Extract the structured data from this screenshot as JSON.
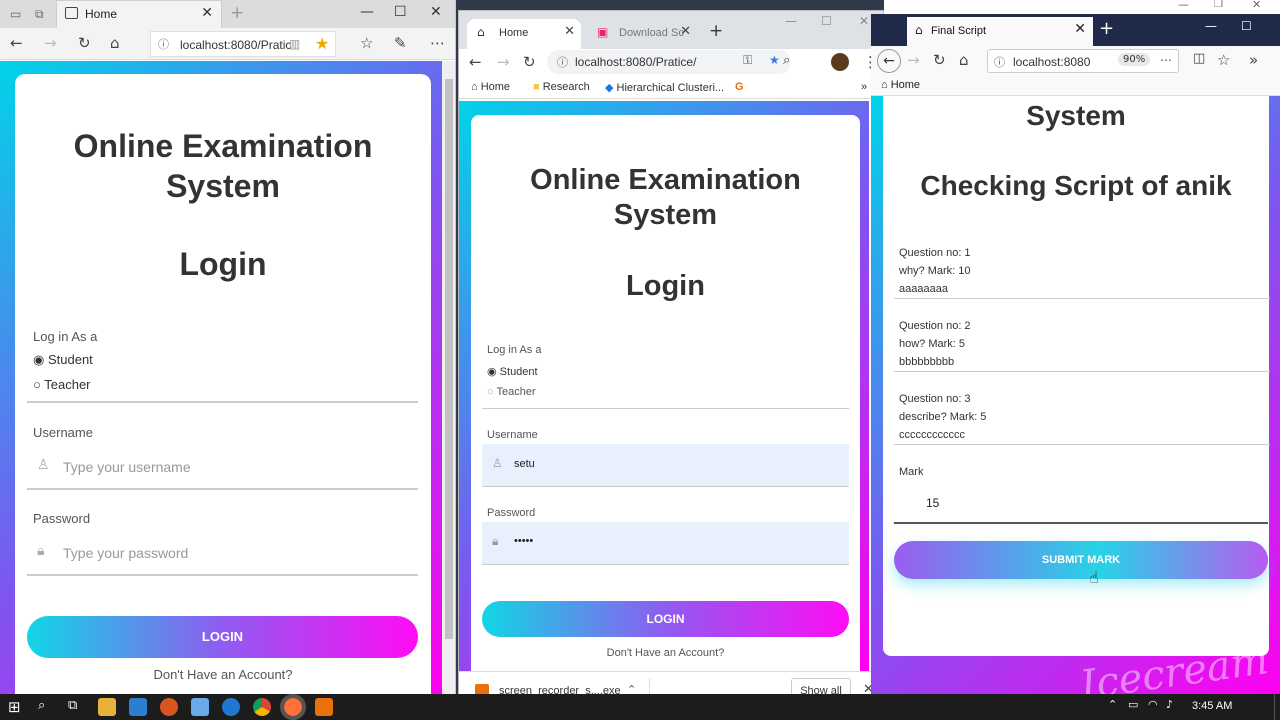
{
  "left": {
    "tab_title": "Home",
    "url": "localhost:8080/Pratic",
    "title_line1": "Online Examination",
    "title_line2": "System",
    "heading": "Login",
    "login_as": "Log in As a",
    "option_student": "Student",
    "option_teacher": "Teacher",
    "username_label": "Username",
    "username_placeholder": "Type your username",
    "password_label": "Password",
    "password_placeholder": "Type your password",
    "login_button": "LOGIN",
    "signup_link": "Don't Have an Account?"
  },
  "middle": {
    "tab1_title": "Home",
    "tab2_title": "Download Sc",
    "url": "localhost:8080/Pratice/",
    "bookmarks": [
      "Home",
      "Research",
      "Hierarchical Clusteri..."
    ],
    "title_line1": "Online Examination",
    "title_line2": "System",
    "heading": "Login",
    "login_as": "Log in As a",
    "option_student": "Student",
    "option_teacher": "Teacher",
    "username_label": "Username",
    "username_value": "setu",
    "password_label": "Password",
    "password_value": "•••••",
    "login_button": "LOGIN",
    "signup_link": "Don't Have an Account?",
    "download_file": "screen_recorder_s....exe",
    "show_all": "Show all"
  },
  "right": {
    "tab_title": "Final Script",
    "url": "localhost:8080",
    "zoom": "90%",
    "bookmark_home": "Home",
    "title_partial": "System",
    "script_heading": "Checking Script of anik",
    "questions": [
      {
        "no": "Question no: 1",
        "text": "why? Mark: 10",
        "answer": "aaaaaaaa"
      },
      {
        "no": "Question no: 2",
        "text": "how? Mark: 5",
        "answer": "bbbbbbbbb"
      },
      {
        "no": "Question no: 3",
        "text": "describe? Mark: 5",
        "answer": "cccccccccccc"
      }
    ],
    "mark_label": "Mark",
    "mark_value": "15",
    "submit_button": "SUBMIT MARK"
  },
  "taskbar": {
    "time": "3:45 AM"
  },
  "colors": {
    "gradient_start": "#00d4e8",
    "gradient_mid": "#7d56f0",
    "gradient_end": "#ff00f0",
    "firefox_frame": "#1f2a4a",
    "input_fill": "#e8f0fe"
  }
}
